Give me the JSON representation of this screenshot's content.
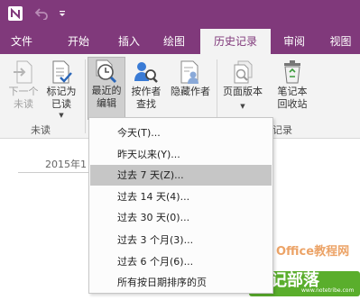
{
  "quick_access": {
    "icons": [
      "onenote-icon",
      "undo-icon",
      "customize-icon"
    ]
  },
  "tabs": [
    {
      "label": "文件"
    },
    {
      "label": "开始"
    },
    {
      "label": "插入"
    },
    {
      "label": "绘图"
    },
    {
      "label": "历史记录",
      "active": true
    },
    {
      "label": "审阅"
    },
    {
      "label": "视图"
    }
  ],
  "ribbon": {
    "unread_group": {
      "label": "未读",
      "next_unread": {
        "label1": "下一个",
        "label2": "未读"
      },
      "mark_read": {
        "label1": "标记为",
        "label2": "已读"
      }
    },
    "authors_group": {
      "recent_edits": {
        "label1": "最近的",
        "label2": "编辑"
      },
      "find_by_author": {
        "label1": "按作者",
        "label2": "查找"
      },
      "hide_authors": {
        "label1": "隐藏作者",
        "label2": ""
      }
    },
    "history_group": {
      "label": "记录",
      "page_versions": {
        "label1": "页面版本",
        "label2": ""
      },
      "notebook_recycle": {
        "label1": "笔记本",
        "label2": "回收站"
      }
    }
  },
  "page": {
    "date": "2015年1"
  },
  "dropdown": {
    "items": [
      {
        "label": "今天(T)..."
      },
      {
        "label": "昨天以来(Y)..."
      },
      {
        "label": "过去 7 天(Z)...",
        "highlighted": true
      },
      {
        "label": "过去 14 天(4)..."
      },
      {
        "label": "过去 30 天(0)..."
      },
      {
        "label": "过去 3 个月(3)..."
      },
      {
        "label": "过去 6 个月(6)..."
      },
      {
        "label": "所有按日期排序的页"
      }
    ]
  },
  "watermark": {
    "text1": "Office教程网",
    "text2": "笔记部落",
    "url": "www.notetribe.com"
  },
  "colors": {
    "accent": "#80397b",
    "ribbon_bg": "#f3f3f3",
    "highlight": "#c6c6c6"
  }
}
